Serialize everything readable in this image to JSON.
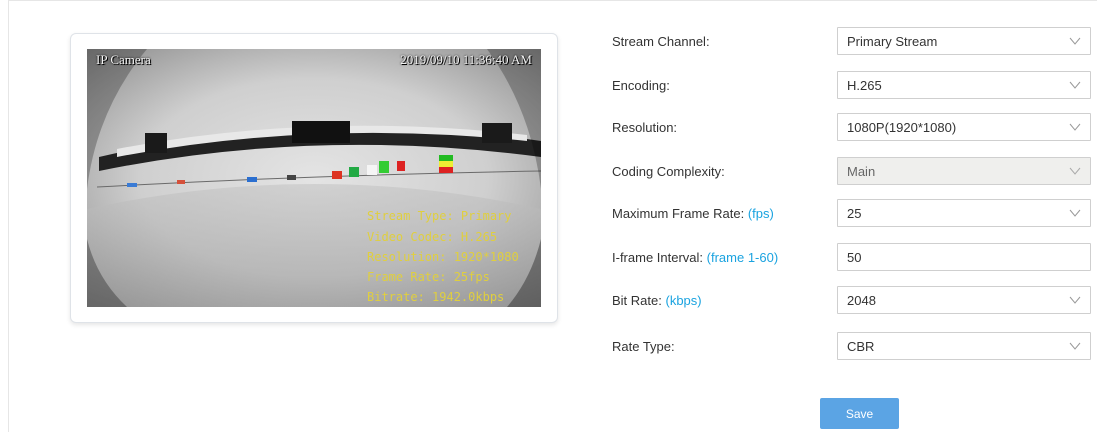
{
  "preview": {
    "camera_name": "IP Camera",
    "timestamp": "2019/09/10 11:36:40 AM",
    "overlay": [
      "Stream Type: Primary",
      "Video Codec: H.265",
      "Resolution: 1920*1080",
      "Frame Rate: 25fps",
      "Bitrate: 1942.0kbps"
    ]
  },
  "form": {
    "stream_channel": {
      "label": "Stream Channel:",
      "value": "Primary Stream"
    },
    "encoding": {
      "label": "Encoding:",
      "value": "H.265"
    },
    "resolution": {
      "label": "Resolution:",
      "value": "1080P(1920*1080)"
    },
    "coding_complexity": {
      "label": "Coding Complexity:",
      "value": "Main"
    },
    "max_frame_rate": {
      "label": "Maximum Frame Rate:",
      "unit": "(fps)",
      "value": "25"
    },
    "iframe_interval": {
      "label": "I-frame Interval:",
      "unit": "(frame 1-60)",
      "value": "50"
    },
    "bit_rate": {
      "label": "Bit Rate:",
      "unit": "(kbps)",
      "value": "2048"
    },
    "rate_type": {
      "label": "Rate Type:",
      "value": "CBR"
    }
  },
  "actions": {
    "save_label": "Save"
  },
  "colors": {
    "accent": "#1aa3e0",
    "button": "#5ba4e4",
    "overlay_text": "#e0cf3e"
  }
}
